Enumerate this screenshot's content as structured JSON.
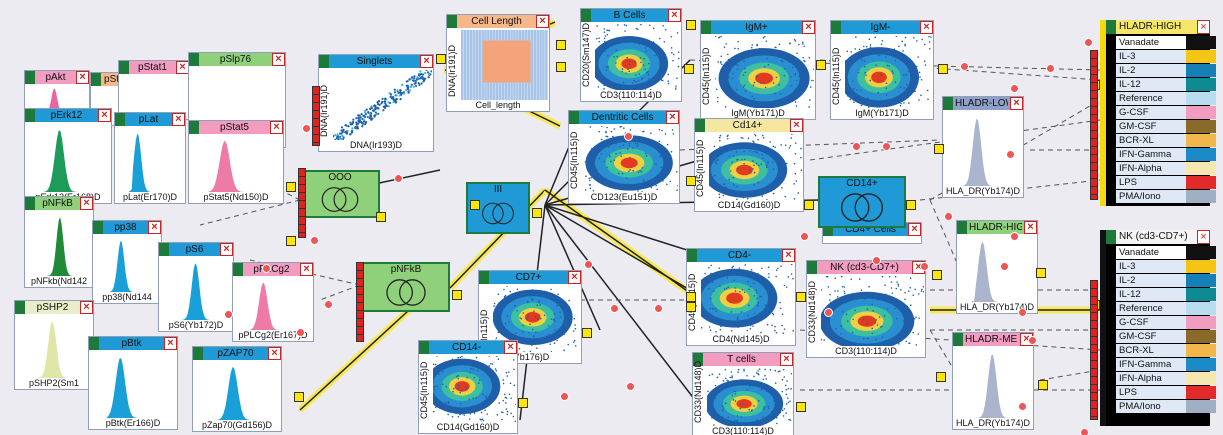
{
  "plots": [
    {
      "id": "pAkt",
      "title": "pAkt",
      "xlabel": "",
      "ylabel": "",
      "bar": "#f29cc0",
      "kind": "hist",
      "color": "#e8669e"
    },
    {
      "id": "pStat3",
      "title": "pStat3",
      "xlabel": "",
      "ylabel": "",
      "bar": "#f6b88a",
      "kind": "none",
      "color": "#f29a5a"
    },
    {
      "id": "pStat1",
      "title": "pStat1",
      "xlabel": "",
      "ylabel": "",
      "bar": "#f29cc0",
      "kind": "none",
      "color": "#e8669e"
    },
    {
      "id": "pSlp76",
      "title": "pSlp76",
      "xlabel": "",
      "ylabel": "",
      "bar": "#8fd07b",
      "kind": "none",
      "color": "#2e8a46"
    },
    {
      "id": "pErk12",
      "title": "pErk12",
      "xlabel": "pErk12(Er168)D",
      "ylabel": "",
      "bar": "#1f9ad6",
      "kind": "hist",
      "color": "#1e9a5a"
    },
    {
      "id": "pLat",
      "title": "pLat",
      "xlabel": "pLat(Er170)D",
      "ylabel": "",
      "bar": "#1f9ad6",
      "kind": "hist",
      "color": "#1aa0d8"
    },
    {
      "id": "pStat5",
      "title": "pStat5",
      "xlabel": "pStat5(Nd150)D",
      "ylabel": "",
      "bar": "#f29cc0",
      "kind": "hist",
      "color": "#ee7aa6"
    },
    {
      "id": "pNFkBp",
      "title": "pNFkB",
      "xlabel": "pNFkb(Nd142",
      "ylabel": "",
      "bar": "#8fd07b",
      "kind": "hist",
      "color": "#1e8a3a"
    },
    {
      "id": "pp38",
      "title": "pp38",
      "xlabel": "pp38(Nd144",
      "ylabel": "",
      "bar": "#1f9ad6",
      "kind": "hist",
      "color": "#1aa0d8"
    },
    {
      "id": "pS6",
      "title": "pS6",
      "xlabel": "pS6(Yb172)D",
      "ylabel": "",
      "bar": "#1f9ad6",
      "kind": "hist",
      "color": "#1aa0d8"
    },
    {
      "id": "pPLCg2",
      "title": "pPLCg2",
      "xlabel": "pPLCg2(Er167)D",
      "ylabel": "",
      "bar": "#f29cc0",
      "kind": "hist",
      "color": "#ee7aa6"
    },
    {
      "id": "pSHP2",
      "title": "pSHP2",
      "xlabel": "pSHP2(Sm1",
      "ylabel": "",
      "bar": "#e9edc9",
      "kind": "hist",
      "color": "#dfe6a8"
    },
    {
      "id": "pBtk",
      "title": "pBtk",
      "xlabel": "pBtk(Er166)D",
      "ylabel": "",
      "bar": "#1f9ad6",
      "kind": "hist",
      "color": "#1aa0d8"
    },
    {
      "id": "pZAP70",
      "title": "pZAP70",
      "xlabel": "pZap70(Gd156)D",
      "ylabel": "",
      "bar": "#1f9ad6",
      "kind": "hist",
      "color": "#1aa0d8"
    },
    {
      "id": "singlets",
      "title": "Singlets",
      "xlabel": "DNA(Ir193)D",
      "ylabel": "DNA(Ir191)D",
      "bar": "#1f9ad6",
      "kind": "diag",
      "color": "#1aa0d8"
    },
    {
      "id": "celllength",
      "title": "Cell Length",
      "xlabel": "Cell_length",
      "ylabel": "DNA(Ir191)D",
      "bar": "#f6b88a",
      "kind": "cl",
      "color": "#f6b88a"
    },
    {
      "id": "bcells",
      "title": "B Cells",
      "xlabel": "CD3(110:114)D",
      "ylabel": "CD20(Sm147)D",
      "bar": "#1f9ad6",
      "kind": "dens",
      "color": "#1aa0d8"
    },
    {
      "id": "igmp",
      "title": "IgM+",
      "xlabel": "IgM(Yb171)D",
      "ylabel": "CD45(In115)D",
      "bar": "#1f9ad6",
      "kind": "dens",
      "color": "#1aa0d8"
    },
    {
      "id": "igmm",
      "title": "IgM-",
      "xlabel": "IgM(Yb171)D",
      "ylabel": "CD45(In115)D",
      "bar": "#1f9ad6",
      "kind": "dens",
      "color": "#1aa0d8"
    },
    {
      "id": "dendritic",
      "title": "Dentritic Cells",
      "xlabel": "CD123(Eu151)D",
      "ylabel": "CD45(In115)D",
      "bar": "#1f9ad6",
      "kind": "dens",
      "color": "#1aa0d8"
    },
    {
      "id": "cd14p",
      "title": "Cd14+",
      "xlabel": "CD14(Gd160)D",
      "ylabel": "CD45(In115)D",
      "bar": "#f6e7a0",
      "kind": "dens",
      "color": "#1aa0d8"
    },
    {
      "id": "hladrlow",
      "title": "HLADR-LOW",
      "xlabel": "HLA_DR(Yb174)D",
      "ylabel": "",
      "bar": "#8fa0c8",
      "kind": "hist",
      "color": "#aab4cc"
    },
    {
      "id": "hladrhigh2",
      "title": "HLADR-HIGH",
      "xlabel": "HLA_DR(Yb174)D",
      "ylabel": "",
      "bar": "#8fd07b",
      "kind": "hist",
      "color": "#aab4cc"
    },
    {
      "id": "cd4pcells",
      "title": "CD4+ Cells",
      "xlabel": "",
      "ylabel": "",
      "bar": "#1f9ad6",
      "kind": "none",
      "color": "#1aa0d8"
    },
    {
      "id": "cd4m",
      "title": "CD4-",
      "xlabel": "CD4(Nd145)D",
      "ylabel": "CD45(In115)D",
      "bar": "#1f9ad6",
      "kind": "dens",
      "color": "#1aa0d8"
    },
    {
      "id": "cd7p",
      "title": "CD7+",
      "xlabel": "(Yb176)D",
      "ylabel": "5(In115)D",
      "bar": "#1f9ad6",
      "kind": "dens",
      "color": "#1aa0d8"
    },
    {
      "id": "cd14m",
      "title": "CD14-",
      "xlabel": "CD14(Gd160)D",
      "ylabel": "CD45(In115)D",
      "bar": "#1f9ad6",
      "kind": "dens",
      "color": "#1aa0d8"
    },
    {
      "id": "nkcells",
      "title": "NK (cd3-CD7+)",
      "xlabel": "CD3(110:114)D",
      "ylabel": "CD33(Nd148)D",
      "bar": "#f29cc0",
      "kind": "dens",
      "color": "#1aa0d8"
    },
    {
      "id": "hladrmed",
      "title": "HLADR-MED",
      "xlabel": "HLA_DR(Yb174)D",
      "ylabel": "",
      "bar": "#f29cc0",
      "kind": "hist",
      "color": "#aab4cc"
    },
    {
      "id": "tcells",
      "title": "T cells",
      "xlabel": "CD3(110:114)D",
      "ylabel": "CD33(Nd148)D",
      "bar": "#f29cc0",
      "kind": "dens",
      "color": "#1aa0d8"
    }
  ],
  "gates": [
    {
      "id": "ooo",
      "title": "OOO",
      "fill": "#8fd07b"
    },
    {
      "id": "pnfkbg",
      "title": "pNFkB",
      "fill": "#8fd07b"
    },
    {
      "id": "iii",
      "title": "III",
      "fill": "#1f9ad6"
    },
    {
      "id": "cd14pg",
      "title": "CD14+",
      "fill": "#1f9ad6"
    }
  ],
  "tables": [
    {
      "id": "t1",
      "title": "HLADR-HIGH",
      "rows": [
        {
          "label": "Vanadate",
          "color": "#000000"
        },
        {
          "label": "IL-3",
          "color": "#f5c516"
        },
        {
          "label": "IL-2",
          "color": "#1580b8"
        },
        {
          "label": "IL-12",
          "color": "#0e8a92"
        },
        {
          "label": "Reference",
          "color": "#b8dcf0"
        },
        {
          "label": "G-CSF",
          "color": "#f29cc0"
        },
        {
          "label": "GM-CSF",
          "color": "#8a6a2a"
        },
        {
          "label": "BCR-XL",
          "color": "#f3b64a"
        },
        {
          "label": "IFN-Gamma",
          "color": "#1a8ac8"
        },
        {
          "label": "IFN-Alpha",
          "color": "#f6e7b0"
        },
        {
          "label": "LPS",
          "color": "#e22a2a"
        },
        {
          "label": "PMA/Iono",
          "color": "#9fb0c4"
        }
      ]
    },
    {
      "id": "t2",
      "title": "NK (cd3-CD7+)",
      "rows": [
        {
          "label": "Vanadate",
          "color": "#000000"
        },
        {
          "label": "IL-3",
          "color": "#f5c516"
        },
        {
          "label": "IL-2",
          "color": "#1580b8"
        },
        {
          "label": "IL-12",
          "color": "#0e8a92"
        },
        {
          "label": "Reference",
          "color": "#b8dcf0"
        },
        {
          "label": "G-CSF",
          "color": "#f29cc0"
        },
        {
          "label": "GM-CSF",
          "color": "#8a6a2a"
        },
        {
          "label": "BCR-XL",
          "color": "#f3b64a"
        },
        {
          "label": "IFN-Gamma",
          "color": "#1a8ac8"
        },
        {
          "label": "IFN-Alpha",
          "color": "#f6e7b0"
        },
        {
          "label": "LPS",
          "color": "#e22a2a"
        },
        {
          "label": "PMA/Iono",
          "color": "#9fb0c4"
        }
      ]
    }
  ]
}
